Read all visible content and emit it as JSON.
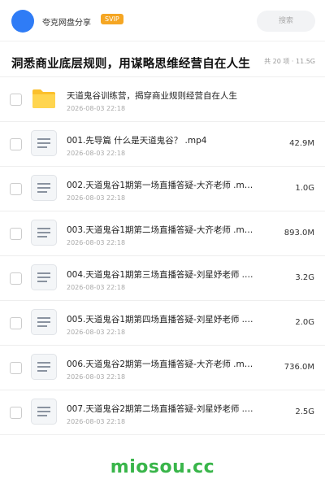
{
  "header": {
    "owner": "夸克网盘分享",
    "badge": "SVIP",
    "search_placeholder": "搜索"
  },
  "share": {
    "title": "洞悉商业底层规则，用谋略思维经营自在人生",
    "meta": "共 20 项 · 11.5G"
  },
  "files": [
    {
      "type": "folder",
      "name": "天道鬼谷训练营，揭穿商业规则经营自在人生",
      "date": "2026-08-03 22:18",
      "size": ""
    },
    {
      "type": "file",
      "name": "001.先导篇 什么是天道鬼谷？ .mp4",
      "date": "2026-08-03 22:18",
      "size": "42.9M"
    },
    {
      "type": "file",
      "name": "002.天道鬼谷1期第一场直播答疑-大齐老师 .m…",
      "date": "2026-08-03 22:18",
      "size": "1.0G"
    },
    {
      "type": "file",
      "name": "003.天道鬼谷1期第二场直播答疑-大齐老师 .m…",
      "date": "2026-08-03 22:18",
      "size": "893.0M"
    },
    {
      "type": "file",
      "name": "004.天道鬼谷1期第三场直播答疑-刘星妤老师 .…",
      "date": "2026-08-03 22:18",
      "size": "3.2G"
    },
    {
      "type": "file",
      "name": "005.天道鬼谷1期第四场直播答疑-刘星妤老师 .…",
      "date": "2026-08-03 22:18",
      "size": "2.0G"
    },
    {
      "type": "file",
      "name": "006.天道鬼谷2期第一场直播答疑-大齐老师 .m…",
      "date": "2026-08-03 22:18",
      "size": "736.0M"
    },
    {
      "type": "file",
      "name": "007.天道鬼谷2期第二场直播答疑-刘星妤老师 .…",
      "date": "2026-08-03 22:18",
      "size": "2.5G"
    }
  ],
  "watermark": "miosou.cc",
  "colors": {
    "accent": "#2f7cf6",
    "badge": "#f5a623",
    "folder": "#fbc02d",
    "watermark": "#39b54a"
  }
}
